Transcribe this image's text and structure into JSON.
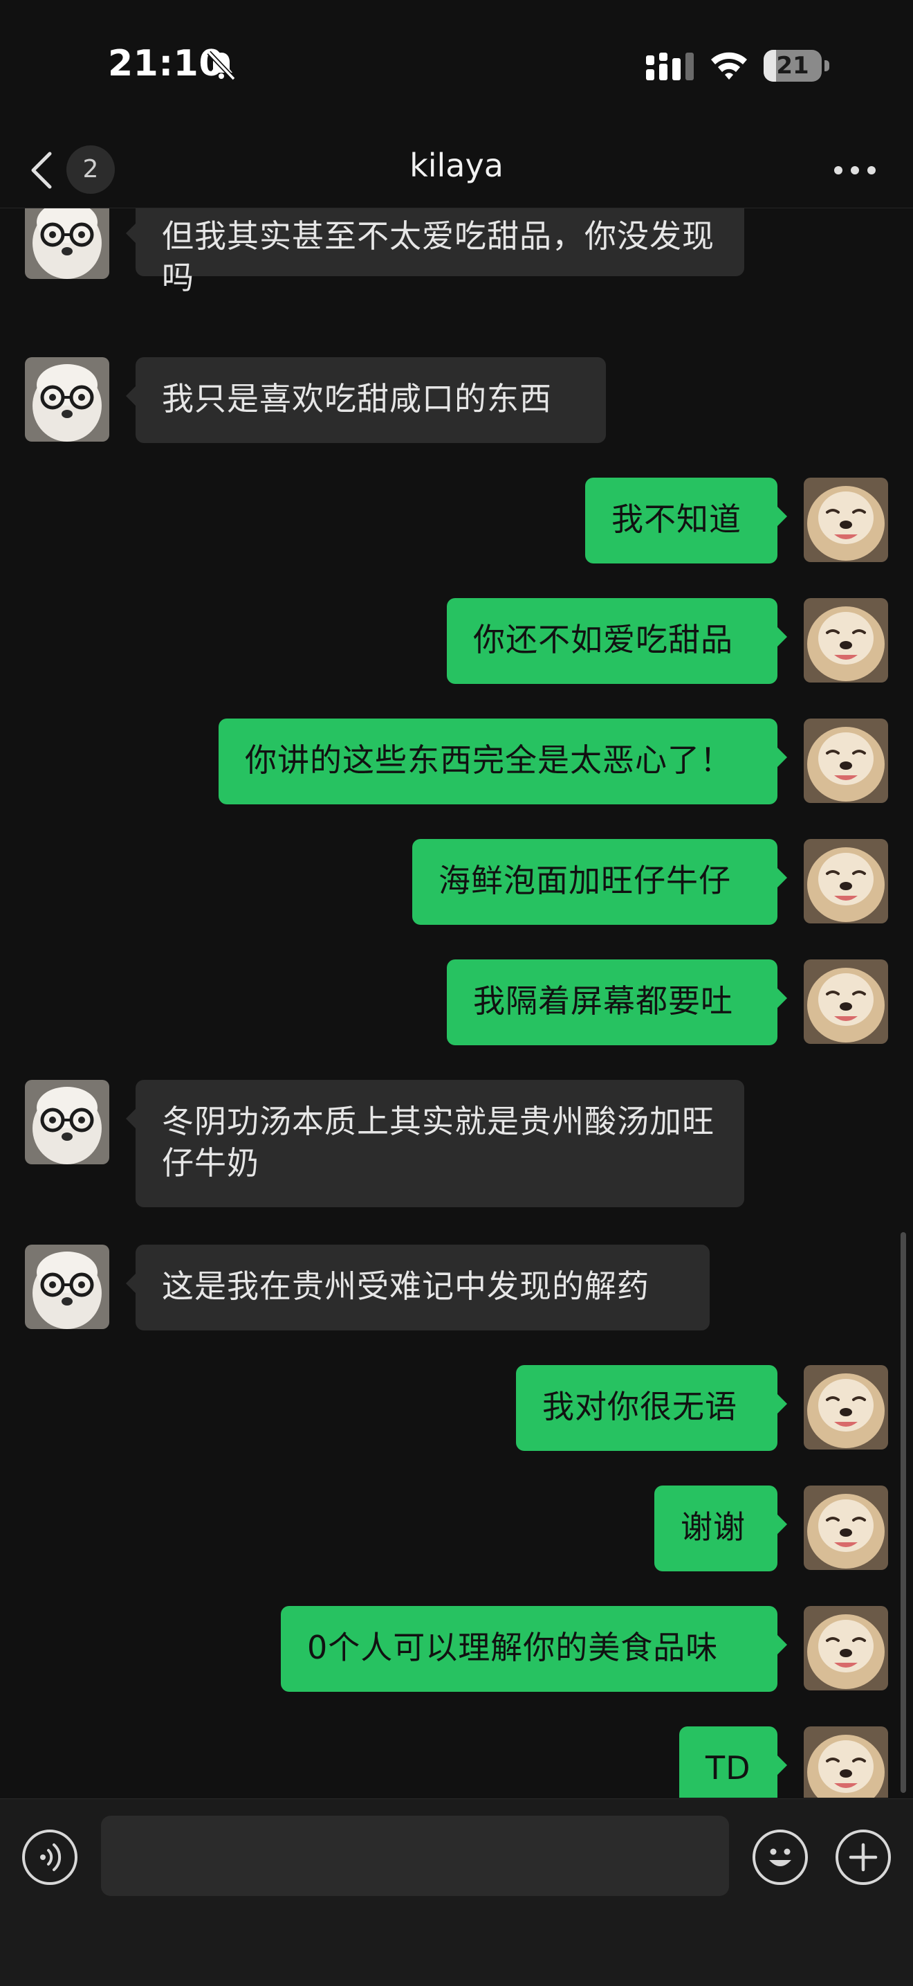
{
  "status_bar": {
    "time": "21:10",
    "battery": "21",
    "battery_level": 0.21
  },
  "nav": {
    "unread_count": "2",
    "title": "kilaya"
  },
  "messages": [
    {
      "side": "left",
      "text": "但我其实甚至不太爱吃甜品，你没发现吗"
    },
    {
      "side": "left",
      "text": "我只是喜欢吃甜咸口的东西"
    },
    {
      "side": "right",
      "text": "我不知道"
    },
    {
      "side": "right",
      "text": "你还不如爱吃甜品"
    },
    {
      "side": "right",
      "text": "你讲的这些东西完全是太恶心了！"
    },
    {
      "side": "right",
      "text": "海鲜泡面加旺仔牛仔"
    },
    {
      "side": "right",
      "text": "我隔着屏幕都要吐"
    },
    {
      "side": "left",
      "text": "冬阴功汤本质上其实就是贵州酸汤加旺仔牛奶"
    },
    {
      "side": "left",
      "text": "这是我在贵州受难记中发现的解药"
    },
    {
      "side": "right",
      "text": "我对你很无语"
    },
    {
      "side": "right",
      "text": "谢谢"
    },
    {
      "side": "right",
      "text": "0个人可以理解你的美食品味"
    },
    {
      "side": "right",
      "text": "TD"
    }
  ],
  "input": {
    "placeholder": "",
    "value": ""
  },
  "colors": {
    "background": "#111111",
    "sent_bubble": "#27c261",
    "received_bubble": "#2c2c2c"
  }
}
